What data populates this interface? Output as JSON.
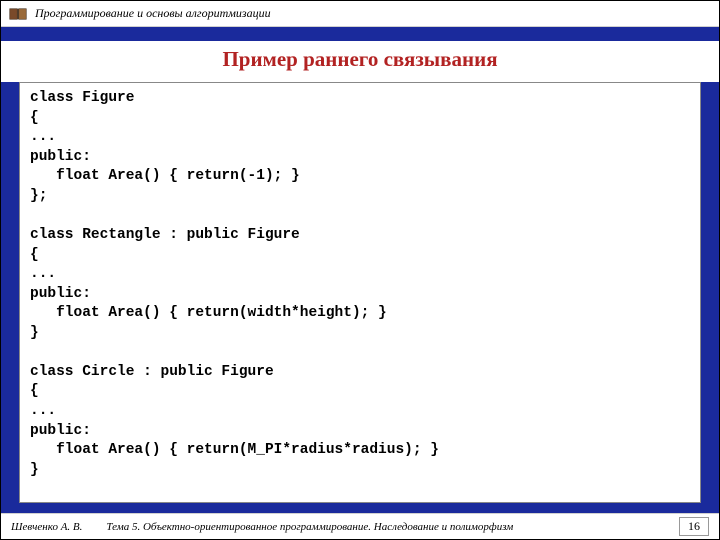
{
  "header": {
    "course_title": "Программирование и основы алгоритмизации"
  },
  "title": "Пример раннего связывания",
  "code": "class Figure\n{\n...\npublic:\n   float Area() { return(-1); }\n};\n\nclass Rectangle : public Figure\n{\n...\npublic:\n   float Area() { return(width*height); }\n}\n\nclass Circle : public Figure\n{\n...\npublic:\n   float Area() { return(M_PI*radius*radius); }\n}",
  "footer": {
    "author": "Шевченко А. В.",
    "topic": "Тема 5. Объектно-ориентированное программирование. Наследование и полиморфизм",
    "page": "16"
  }
}
